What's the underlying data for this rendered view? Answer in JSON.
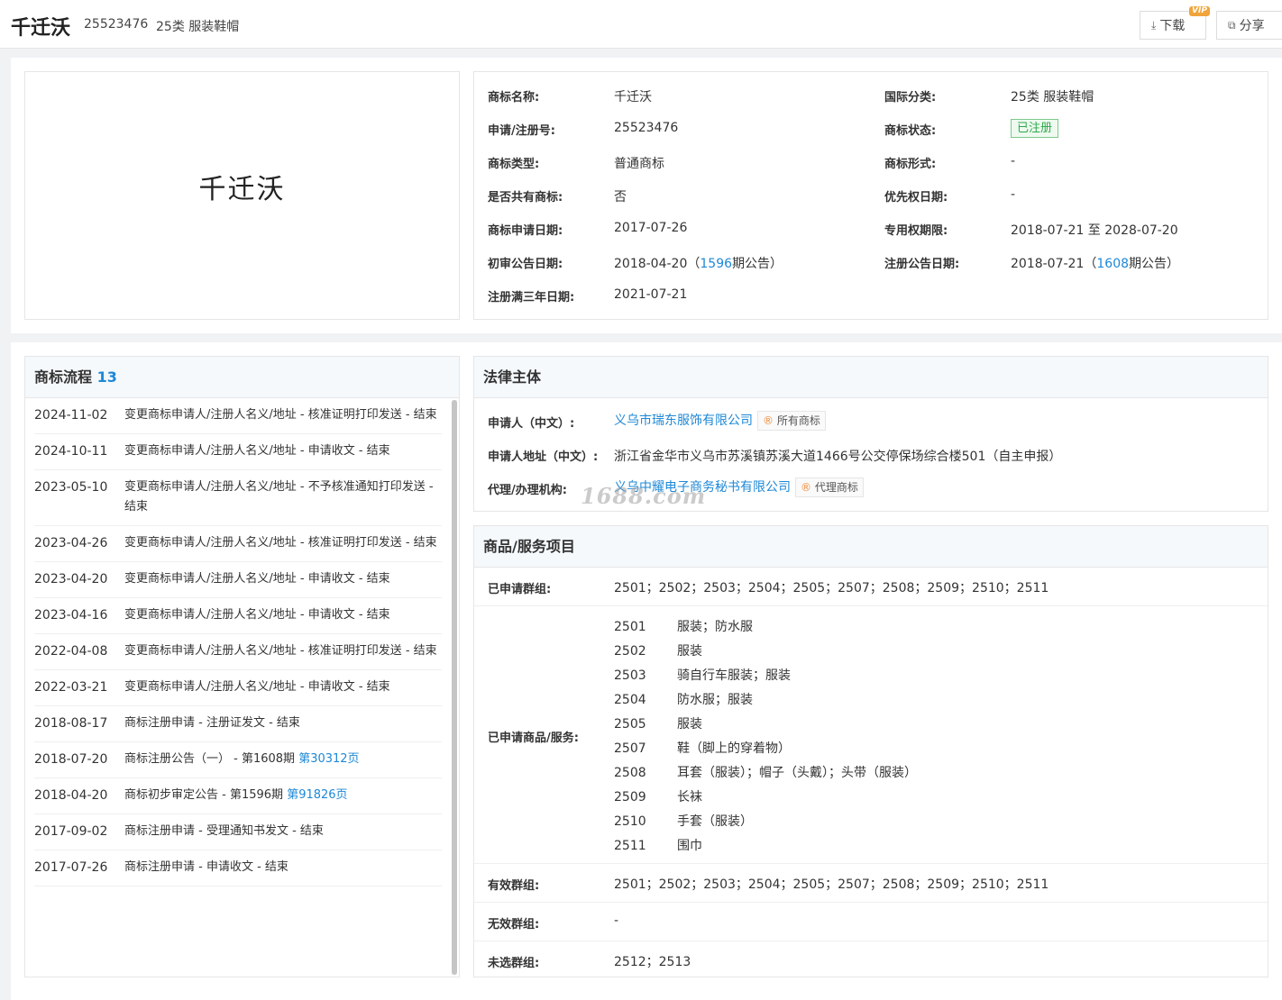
{
  "header": {
    "title": "千迁沃",
    "reg_no": "25523476",
    "class": "25类 服装鞋帽",
    "download_label": "下载",
    "vip_label": "VIP",
    "share_label": "分享"
  },
  "logo_text": "千迁沃",
  "info": {
    "name_label": "商标名称:",
    "name": "千迁沃",
    "intl_class_label": "国际分类:",
    "intl_class": "25类 服装鞋帽",
    "reg_no_label": "申请/注册号:",
    "reg_no": "25523476",
    "status_label": "商标状态:",
    "status": "已注册",
    "type_label": "商标类型:",
    "type": "普通商标",
    "form_label": "商标形式:",
    "form": "-",
    "shared_label": "是否共有商标:",
    "shared": "否",
    "priority_label": "优先权日期:",
    "priority": "-",
    "apply_date_label": "商标申请日期:",
    "apply_date": "2017-07-26",
    "exclusive_label": "专用权期限:",
    "exclusive": "2018-07-21 至 2028-07-20",
    "prelim_label": "初审公告日期:",
    "prelim_date": "2018-04-20（",
    "prelim_issue": "1596",
    "prelim_suffix": "期公告）",
    "reg_pub_label": "注册公告日期:",
    "reg_pub_date": "2018-07-21（",
    "reg_pub_issue": "1608",
    "reg_pub_suffix": "期公告）",
    "three_year_label": "注册满三年日期:",
    "three_year": "2021-07-21"
  },
  "flow": {
    "title": "商标流程",
    "count": "13",
    "items": [
      {
        "date": "2024-11-02",
        "desc": "变更商标申请人/注册人名义/地址 - 核准证明打印发送 - 结束"
      },
      {
        "date": "2024-10-11",
        "desc": "变更商标申请人/注册人名义/地址 - 申请收文 - 结束"
      },
      {
        "date": "2023-05-10",
        "desc": "变更商标申请人/注册人名义/地址 - 不予核准通知打印发送 - 结束"
      },
      {
        "date": "2023-04-26",
        "desc": "变更商标申请人/注册人名义/地址 - 核准证明打印发送 - 结束"
      },
      {
        "date": "2023-04-20",
        "desc": "变更商标申请人/注册人名义/地址 - 申请收文 - 结束"
      },
      {
        "date": "2023-04-16",
        "desc": "变更商标申请人/注册人名义/地址 - 申请收文 - 结束"
      },
      {
        "date": "2022-04-08",
        "desc": "变更商标申请人/注册人名义/地址 - 核准证明打印发送 - 结束"
      },
      {
        "date": "2022-03-21",
        "desc": "变更商标申请人/注册人名义/地址 - 申请收文 - 结束"
      },
      {
        "date": "2018-08-17",
        "desc": "商标注册申请 - 注册证发文 - 结束"
      },
      {
        "date": "2018-07-20",
        "desc": "商标注册公告（一） - 第1608期 ",
        "link": "第30312页"
      },
      {
        "date": "2018-04-20",
        "desc": "商标初步审定公告 - 第1596期 ",
        "link": "第91826页"
      },
      {
        "date": "2017-09-02",
        "desc": "商标注册申请 - 受理通知书发文 - 结束"
      },
      {
        "date": "2017-07-26",
        "desc": "商标注册申请 - 申请收文 - 结束"
      }
    ]
  },
  "legal": {
    "title": "法律主体",
    "applicant_label": "申请人（中文）:",
    "applicant": "义乌市瑞东服饰有限公司",
    "applicant_tag": "所有商标",
    "address_label": "申请人地址（中文）:",
    "address": "浙江省金华市义乌市苏溪镇苏溪大道1466号公交停保场综合楼501（自主申报）",
    "agent_label": "代理/办理机构:",
    "agent": "义乌中耀电子商务秘书有限公司",
    "agent_tag": "代理商标",
    "watermark": "1688.com"
  },
  "goods": {
    "title": "商品/服务项目",
    "applied_groups_label": "已申请群组:",
    "applied_groups": "2501；2502；2503；2504；2505；2507；2508；2509；2510；2511",
    "applied_goods_label": "已申请商品/服务:",
    "items": [
      {
        "code": "2501",
        "name": "服装；防水服"
      },
      {
        "code": "2502",
        "name": "服装"
      },
      {
        "code": "2503",
        "name": "骑自行车服装；服装"
      },
      {
        "code": "2504",
        "name": "防水服；服装"
      },
      {
        "code": "2505",
        "name": "服装"
      },
      {
        "code": "2507",
        "name": "鞋（脚上的穿着物）"
      },
      {
        "code": "2508",
        "name": "耳套（服装）；帽子（头戴）；头带（服装）"
      },
      {
        "code": "2509",
        "name": "长袜"
      },
      {
        "code": "2510",
        "name": "手套（服装）"
      },
      {
        "code": "2511",
        "name": "围巾"
      }
    ],
    "valid_groups_label": "有效群组:",
    "valid_groups": "2501；2502；2503；2504；2505；2507；2508；2509；2510；2511",
    "invalid_groups_label": "无效群组:",
    "invalid_groups": "-",
    "unselected_groups_label": "未选群组:",
    "unselected_groups": "2512；2513"
  }
}
